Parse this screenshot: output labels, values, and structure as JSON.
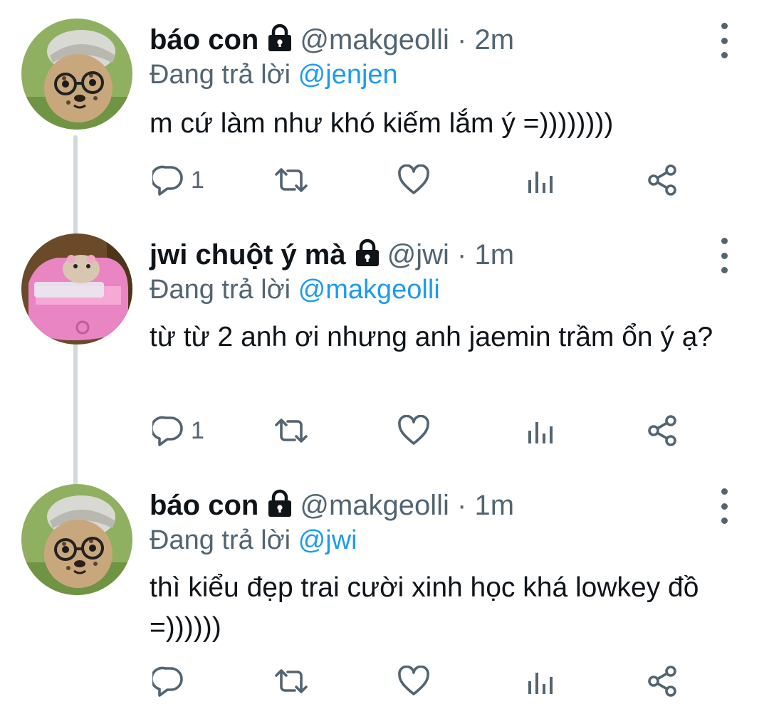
{
  "colors": {
    "accent": "#1d9bf0",
    "secondary": "#536471",
    "thread_line": "#cfd9de"
  },
  "tweets": [
    {
      "name": "báo con",
      "locked": true,
      "handle": "@makgeolli",
      "dot": "·",
      "time": "2m",
      "replying_prefix": "Đang trả lời ",
      "replying_to": "@jenjen",
      "text": "m cứ làm như khó kiếm lắm ý =))))))))",
      "reply_count": "1",
      "avatar": "cheetah-cub-with-glasses"
    },
    {
      "name": "jwi chuột ý mà",
      "locked": true,
      "handle": "@jwi",
      "dot": "·",
      "time": "1m",
      "replying_prefix": "Đang trả lời ",
      "replying_to": "@makgeolli",
      "text": "từ từ 2 anh ơi nhưng anh jaemin trầm ổn ý ạ?",
      "reply_count": "1",
      "avatar": "hamster-in-pink-car"
    },
    {
      "name": "báo con",
      "locked": true,
      "handle": "@makgeolli",
      "dot": "·",
      "time": "1m",
      "replying_prefix": "Đang trả lời ",
      "replying_to": "@jwi",
      "text": "thì kiểu đẹp trai cười xinh học khá lowkey đồ =))))))",
      "reply_count": "",
      "avatar": "cheetah-cub-with-glasses"
    }
  ],
  "icons": {
    "reply": "reply-icon",
    "retweet": "retweet-icon",
    "like": "heart-icon",
    "views": "analytics-icon",
    "share": "share-icon",
    "more": "more-vertical-icon",
    "lock": "lock-icon"
  }
}
